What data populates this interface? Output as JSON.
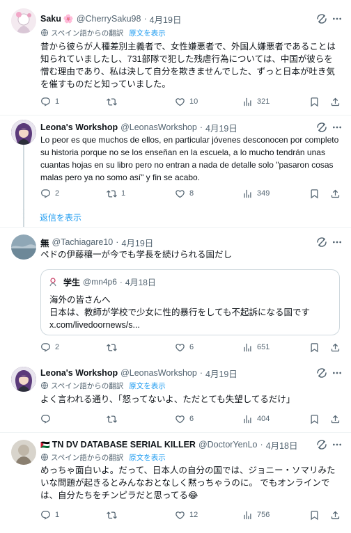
{
  "translate": {
    "label": "スペイン語からの翻訳",
    "link": "原文を表示"
  },
  "show_more": "返信を表示",
  "posts": [
    {
      "name": "Saku",
      "name_emoji": "🌸",
      "handle": "@CherrySaku98",
      "date": "4月19日",
      "text": "昔から彼らが人種差別主義者で、女性嫌悪者で、外国人嫌悪者であることは知られていましたし、731部隊で犯した残虐行為については、中国が彼らを憎む理由であり、私は決して自分を欺きませんでした、ずっと日本が吐き気を催すものだと知っていました。",
      "replies": "1",
      "reposts": "",
      "likes": "10",
      "views": "321"
    },
    {
      "name": "Leona's Workshop",
      "handle": "@LeonasWorkshop",
      "date": "4月19日",
      "text": "Lo peor es que muchos de ellos, en particular jóvenes desconocen por completo su historia porque no se los enseñan en la escuela, a lo mucho tendrán unas cuantas hojas en su libro pero no entran a nada de detalle solo \"pasaron cosas malas pero ya no somo así\" y fin se acabo.",
      "replies": "2",
      "reposts": "1",
      "likes": "8",
      "views": "349"
    },
    {
      "name": "無",
      "handle": "@Tachiagare10",
      "date": "4月19日",
      "text": "ペドの伊藤穰一が今でも学長を続けられる国だし",
      "quote": {
        "name": "学生",
        "handle": "@mn4p6",
        "date": "4月18日",
        "text": "海外の皆さんへ\n日本は、教師が学校で少女に性的暴行をしても不起訴になる国です\nx.com/livedoornews/s..."
      },
      "replies": "2",
      "reposts": "",
      "likes": "6",
      "views": "651"
    },
    {
      "name": "Leona's Workshop",
      "handle": "@LeonasWorkshop",
      "date": "4月19日",
      "text": "よく言われる通り、「怒ってないよ、ただとても失望してるだけ」",
      "replies": "",
      "reposts": "",
      "likes": "6",
      "views": "404"
    },
    {
      "name": "TN DV DATABASE SERIAL KILLER",
      "name_prefix": "🇵🇸",
      "handle": "@DoctorYenLo",
      "date": "4月18日",
      "text": "めっちゃ面白いよ。だって、日本人の自分の国では、ジョニー・ソマリみたいな問題が起きるとみんなおとなしく黙っちゃうのに。 でもオンラインでは、自分たちをチンピラだと思ってる😂",
      "replies": "1",
      "reposts": "",
      "likes": "12",
      "views": "756"
    }
  ],
  "colors": {
    "text": "#0f1419",
    "secondary": "#536471",
    "link": "#1d9bf0",
    "border": "#eff3f4"
  }
}
